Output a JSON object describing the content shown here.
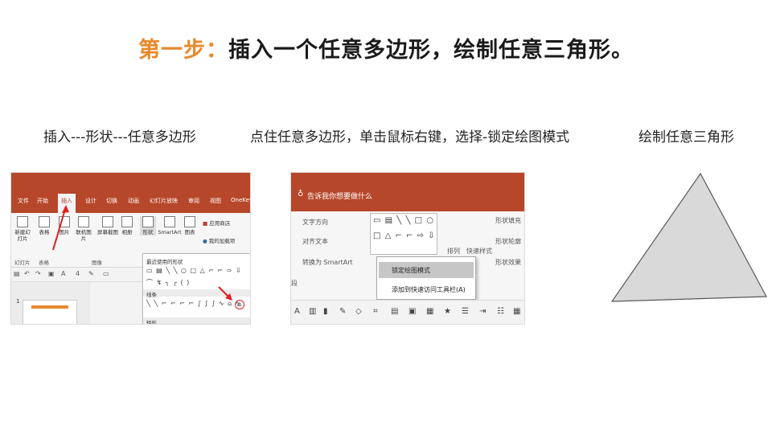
{
  "title": {
    "step": "第一步：",
    "rest": "插入一个任意多边形，绘制任意三角形。"
  },
  "captions": {
    "left": "插入---形状---任意多边形",
    "middle": "点住任意多边形，单击鼠标右键，选择-锁定绘图模式",
    "right": "绘制任意三角形"
  },
  "panel1": {
    "tabs": [
      "文件",
      "开始",
      "插入",
      "设计",
      "切换",
      "动画",
      "幻灯片放映",
      "审阅",
      "视图",
      "OneKey"
    ],
    "active_tab": "插入",
    "ribbon_buttons": [
      "新建幻灯片",
      "表格",
      "图片",
      "联机图片",
      "屏幕截图",
      "相册",
      "形状",
      "SmartArt",
      "图表"
    ],
    "addins": [
      "应用商店",
      "我的加载项"
    ],
    "group_labels": [
      "幻灯片",
      "表格",
      "图像"
    ],
    "dropdown": {
      "recent_header": "最近使用的形状",
      "recent_row1": "▭ ▤ ╲ ╲ ○ □ △ ⌐ ⌐ ⇨ ⇩",
      "recent_row2": "⌒ ↯ ╮ ╭ ( )",
      "lines_header": "线条",
      "lines_row": "╲ ╲ ⌐ ⌐ ⌐ ⌐ ∫ ∫ ∫ ∿ ⌂ ∿",
      "rect_header": "矩形"
    },
    "slide_number": "1"
  },
  "panel2": {
    "tell_me": "告诉我你想要做什么",
    "ribbon_text": [
      "文字方向",
      "对齐文本",
      "转换为 SmartArt",
      "排列",
      "快速样式",
      "形状填充",
      "形状轮廓",
      "形状效果"
    ],
    "shapes_row1": "▭ ▤ ╲ ╲ □ ○",
    "shapes_row2": "□ △ ⌐ ⌐ ⇨ ⇩",
    "context_menu": [
      "锁定绘图模式",
      "添加到快速访问工具栏(A)"
    ],
    "group_label": "段"
  },
  "colors": {
    "accent_orange": "#e8892b",
    "ribbon_red": "#b7472a",
    "triangle_fill": "#d9d9d9",
    "triangle_stroke": "#595959",
    "annotation_red": "#e02020"
  }
}
